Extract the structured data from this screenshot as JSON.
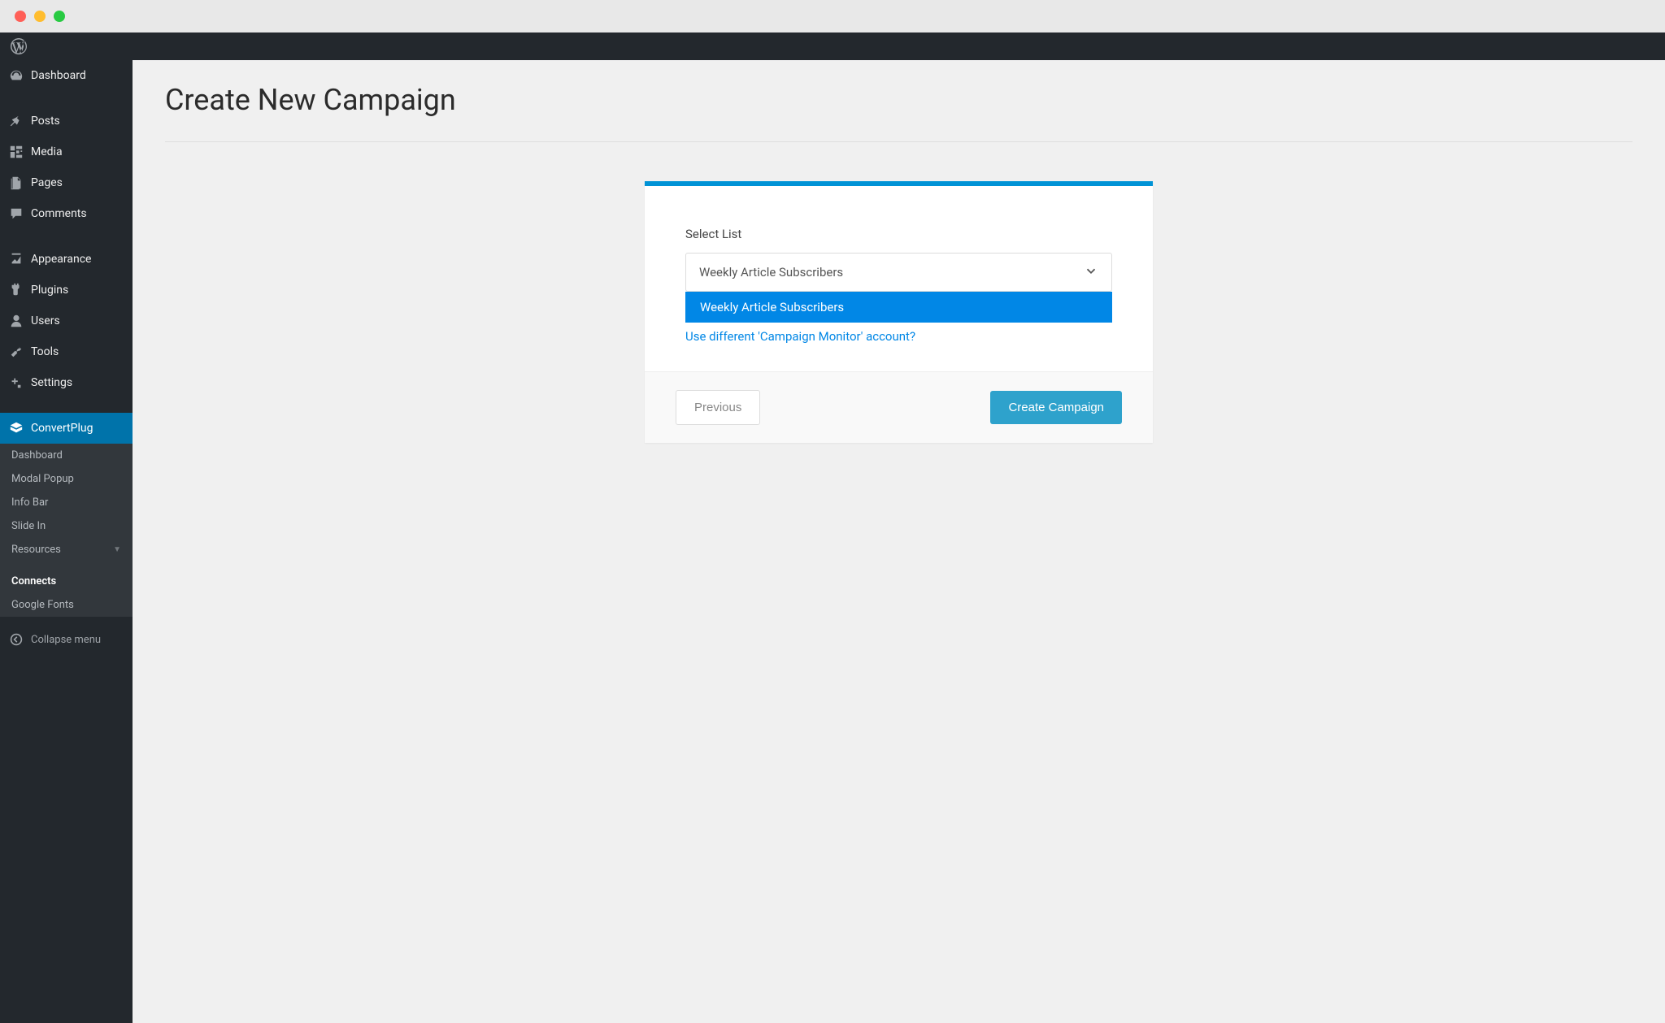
{
  "browser": {
    "traffic_lights": [
      "red",
      "yellow",
      "green"
    ]
  },
  "sidebar": {
    "main_items": [
      {
        "icon": "dashboard",
        "label": "Dashboard"
      },
      {
        "icon": "pin",
        "label": "Posts"
      },
      {
        "icon": "media",
        "label": "Media"
      },
      {
        "icon": "pages",
        "label": "Pages"
      },
      {
        "icon": "comments",
        "label": "Comments"
      }
    ],
    "secondary_items": [
      {
        "icon": "appearance",
        "label": "Appearance"
      },
      {
        "icon": "plugins",
        "label": "Plugins"
      },
      {
        "icon": "users",
        "label": "Users"
      },
      {
        "icon": "tools",
        "label": "Tools"
      },
      {
        "icon": "settings",
        "label": "Settings"
      }
    ],
    "active_item": {
      "icon": "convertplug",
      "label": "ConvertPlug"
    },
    "submenu": [
      {
        "label": "Dashboard",
        "current": false
      },
      {
        "label": "Modal Popup",
        "current": false
      },
      {
        "label": "Info Bar",
        "current": false
      },
      {
        "label": "Slide In",
        "current": false
      },
      {
        "label": "Resources",
        "current": false,
        "has_chevron": true
      },
      {
        "label": "Connects",
        "current": true
      },
      {
        "label": "Google Fonts",
        "current": false
      }
    ],
    "collapse_label": "Collapse menu"
  },
  "main": {
    "page_title": "Create New Campaign",
    "card": {
      "field_label": "Select List",
      "selected_value": "Weekly Article Subscribers",
      "dropdown_option": "Weekly Article Subscribers",
      "alt_account_link": "Use different 'Campaign Monitor' account?",
      "btn_previous": "Previous",
      "btn_create": "Create Campaign"
    }
  }
}
